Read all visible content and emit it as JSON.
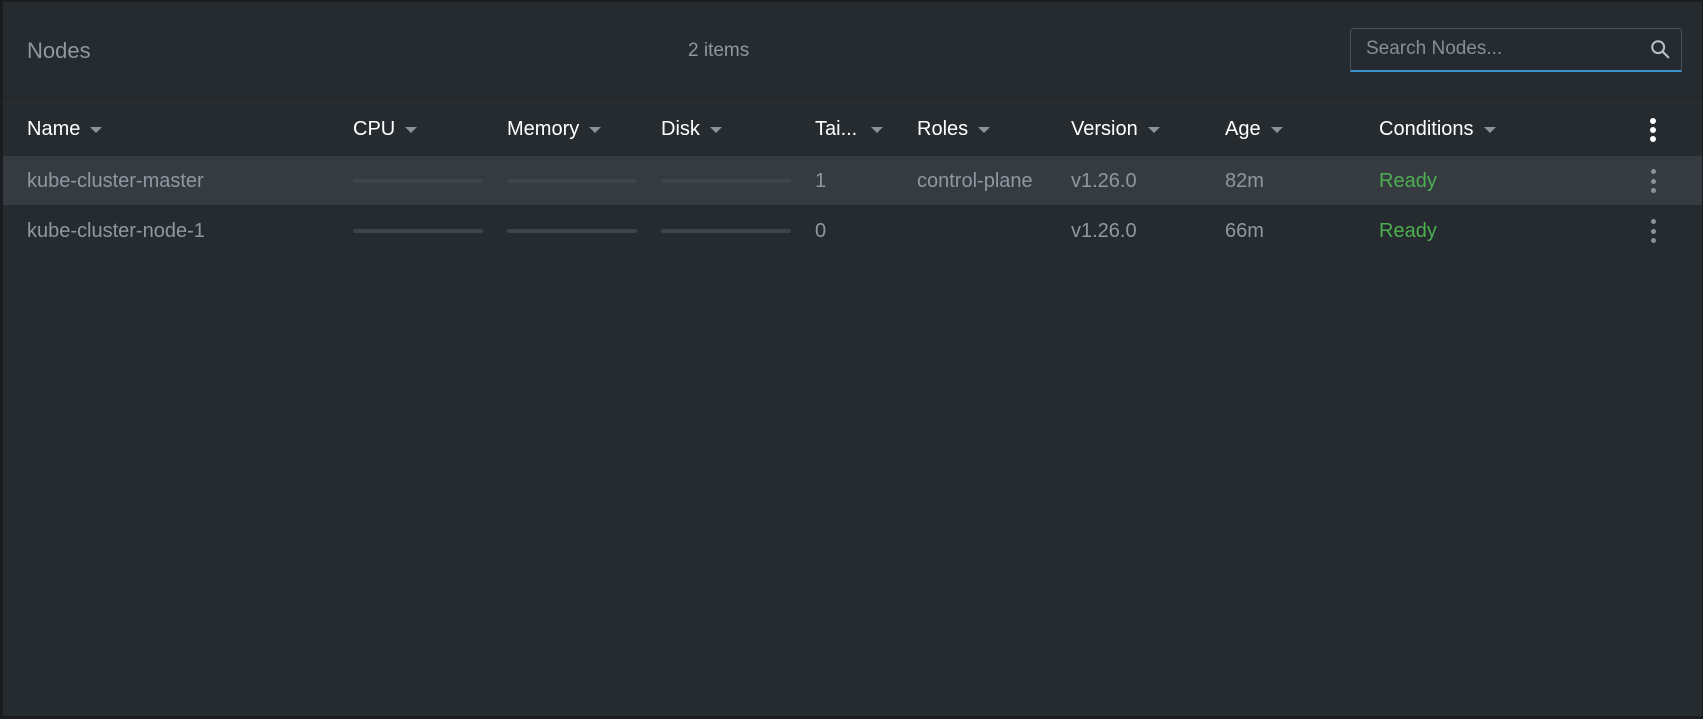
{
  "header": {
    "title": "Nodes",
    "item_count": "2 items",
    "search_placeholder": "Search Nodes..."
  },
  "columns": [
    {
      "key": "name",
      "label": "Name"
    },
    {
      "key": "cpu",
      "label": "CPU"
    },
    {
      "key": "memory",
      "label": "Memory"
    },
    {
      "key": "disk",
      "label": "Disk"
    },
    {
      "key": "taints",
      "label": "Tai..."
    },
    {
      "key": "roles",
      "label": "Roles"
    },
    {
      "key": "version",
      "label": "Version"
    },
    {
      "key": "age",
      "label": "Age"
    },
    {
      "key": "conditions",
      "label": "Conditions"
    }
  ],
  "rows": [
    {
      "name": "kube-cluster-master",
      "cpu_usage": 0,
      "memory_usage": 0,
      "disk_usage": 0,
      "taints": "1",
      "roles": "control-plane",
      "version": "v1.26.0",
      "age": "82m",
      "conditions": "Ready",
      "selected": true
    },
    {
      "name": "kube-cluster-node-1",
      "cpu_usage": 0,
      "memory_usage": 0,
      "disk_usage": 0,
      "taints": "0",
      "roles": "",
      "version": "v1.26.0",
      "age": "66m",
      "conditions": "Ready",
      "selected": false
    }
  ],
  "colors": {
    "background": "#262b2f",
    "selected_row": "#363b42",
    "ready": "#4caf50",
    "accent": "#3d90ce"
  },
  "icons": {
    "search": "search-icon",
    "column_menu": "more-vertical-icon",
    "row_menu": "more-vertical-icon",
    "sort": "caret-down-icon"
  }
}
